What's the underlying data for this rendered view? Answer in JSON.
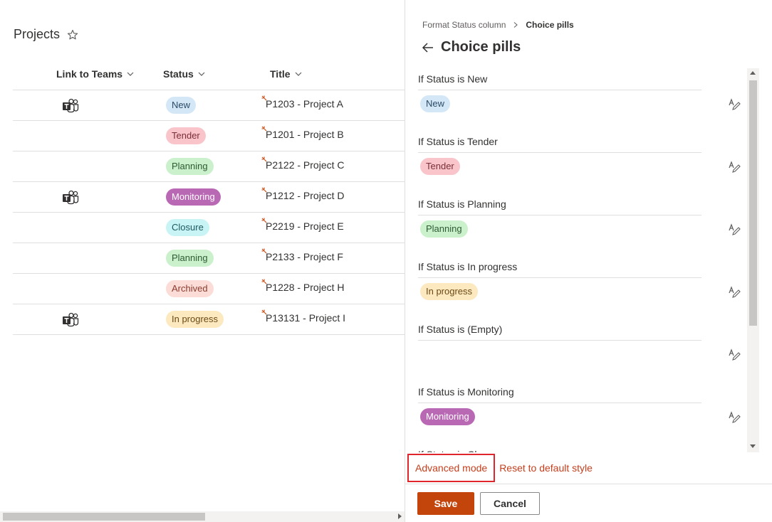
{
  "list": {
    "title": "Projects",
    "columns": {
      "link_to_teams": "Link to Teams",
      "status": "Status",
      "title": "Title"
    },
    "rows": [
      {
        "teams": true,
        "status": "New",
        "status_bg": "#d4e7f6",
        "status_fg": "#2b4b66",
        "title": "P1203 - Project A"
      },
      {
        "teams": false,
        "status": "Tender",
        "status_bg": "#f9c5cb",
        "status_fg": "#7a2e36",
        "title": "P1201 - Project B"
      },
      {
        "teams": false,
        "status": "Planning",
        "status_bg": "#caf0cc",
        "status_fg": "#2e5c31",
        "title": "P2122 - Project C"
      },
      {
        "teams": true,
        "status": "Monitoring",
        "status_bg": "#b968b4",
        "status_fg": "#ffffff",
        "title": "P1212 - Project D"
      },
      {
        "teams": false,
        "status": "Closure",
        "status_bg": "#c9f4f6",
        "status_fg": "#1d5a60",
        "title": "P2219 - Project E"
      },
      {
        "teams": false,
        "status": "Planning",
        "status_bg": "#caf0cc",
        "status_fg": "#2e5c31",
        "title": "P2133 - Project F"
      },
      {
        "teams": false,
        "status": "Archived",
        "status_bg": "#fcdcd7",
        "status_fg": "#8a3b2e",
        "title": "P1228 - Project H"
      },
      {
        "teams": true,
        "status": "In progress",
        "status_bg": "#fde9c0",
        "status_fg": "#6b4a14",
        "title": "P13131 - Project I"
      }
    ]
  },
  "panel": {
    "breadcrumb_parent": "Format Status column",
    "breadcrumb_current": "Choice pills",
    "title": "Choice pills",
    "rules": [
      {
        "label": "If Status is New",
        "pill": "New",
        "bg": "#d4e7f6",
        "fg": "#2b4b66"
      },
      {
        "label": "If Status is Tender",
        "pill": "Tender",
        "bg": "#f9c5cb",
        "fg": "#7a2e36"
      },
      {
        "label": "If Status is Planning",
        "pill": "Planning",
        "bg": "#caf0cc",
        "fg": "#2e5c31"
      },
      {
        "label": "If Status is In progress",
        "pill": "In progress",
        "bg": "#fde9c0",
        "fg": "#6b4a14"
      },
      {
        "label": "If Status is (Empty)",
        "pill": "",
        "bg": "",
        "fg": ""
      },
      {
        "label": "If Status is Monitoring",
        "pill": "Monitoring",
        "bg": "#b968b4",
        "fg": "#ffffff"
      },
      {
        "label": "If Status is Closure",
        "pill": "",
        "bg": "",
        "fg": ""
      }
    ],
    "advanced_mode": "Advanced mode",
    "reset_link": "Reset to default style",
    "save_label": "Save",
    "cancel_label": "Cancel"
  },
  "colors": {
    "accent": "#c4450c",
    "link": "#c43e1c",
    "highlight_border": "#e0262d"
  }
}
